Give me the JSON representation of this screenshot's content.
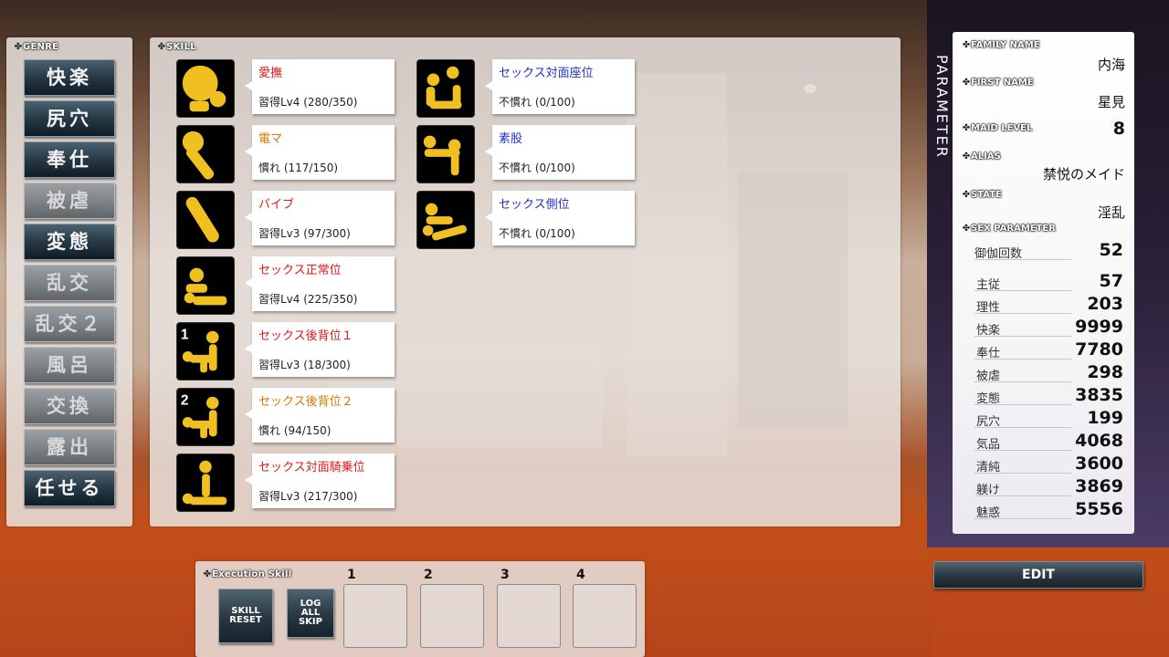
{
  "genre": {
    "title": "GENRE",
    "items": [
      {
        "label": "快楽",
        "enabled": true
      },
      {
        "label": "尻穴",
        "enabled": true
      },
      {
        "label": "奉仕",
        "enabled": true
      },
      {
        "label": "被虐",
        "enabled": false
      },
      {
        "label": "変態",
        "enabled": true
      },
      {
        "label": "乱交",
        "enabled": false
      },
      {
        "label": "乱交２",
        "enabled": false
      },
      {
        "label": "風呂",
        "enabled": false
      },
      {
        "label": "交換",
        "enabled": false
      },
      {
        "label": "露出",
        "enabled": false
      },
      {
        "label": "任せる",
        "enabled": true
      }
    ]
  },
  "skill": {
    "title": "SKILL",
    "left_column": [
      {
        "name": "愛撫",
        "level": "習得Lv4 (280/350)",
        "color": "#e01818",
        "icon": "caress-icon"
      },
      {
        "name": "電マ",
        "level": "慣れ (117/150)",
        "color": "#d87800",
        "icon": "massager-icon"
      },
      {
        "name": "バイブ",
        "level": "習得Lv3 (97/300)",
        "color": "#e01818",
        "icon": "vibrator-icon"
      },
      {
        "name": "セックス正常位",
        "level": "習得Lv4 (225/350)",
        "color": "#e01818",
        "icon": "pose-missionary-icon"
      },
      {
        "name": "セックス後背位１",
        "level": "習得Lv3 (18/300)",
        "color": "#e01818",
        "icon": "pose-rear-1-icon",
        "badge": "1"
      },
      {
        "name": "セックス後背位２",
        "level": "慣れ (94/150)",
        "color": "#d87800",
        "icon": "pose-rear-2-icon",
        "badge": "2"
      },
      {
        "name": "セックス対面騎乗位",
        "level": "習得Lv3 (217/300)",
        "color": "#e01818",
        "icon": "pose-cowgirl-icon"
      }
    ],
    "right_column": [
      {
        "name": "セックス対面座位",
        "level": "不慣れ (0/100)",
        "color": "#2030c8",
        "icon": "pose-seated-icon"
      },
      {
        "name": "素股",
        "level": "不慣れ (0/100)",
        "color": "#2030c8",
        "icon": "pose-thigh-icon"
      },
      {
        "name": "セックス側位",
        "level": "不慣れ (0/100)",
        "color": "#2030c8",
        "icon": "pose-side-icon"
      }
    ]
  },
  "parameter": {
    "vertical_title": "PARAMETER",
    "family_name_label": "FAMILY NAME",
    "family_name": "内海",
    "first_name_label": "FIRST NAME",
    "first_name": "星見",
    "maid_level_label": "MAID LEVEL",
    "maid_level": "8",
    "alias_label": "ALIAS",
    "alias": "禁悦のメイド",
    "state_label": "STATE",
    "state": "淫乱",
    "sex_parameter_label": "SEX PARAMETER",
    "stats": [
      {
        "label": "御伽回数",
        "value": "52"
      },
      {
        "label": "主従",
        "value": "57"
      },
      {
        "label": "理性",
        "value": "203"
      },
      {
        "label": "快楽",
        "value": "9999"
      },
      {
        "label": "奉仕",
        "value": "7780"
      },
      {
        "label": "被虐",
        "value": "298"
      },
      {
        "label": "変態",
        "value": "3835"
      },
      {
        "label": "尻穴",
        "value": "199"
      },
      {
        "label": "気品",
        "value": "4068"
      },
      {
        "label": "清純",
        "value": "3600"
      },
      {
        "label": "躾け",
        "value": "3869"
      },
      {
        "label": "魅惑",
        "value": "5556"
      }
    ],
    "edit_label": "EDIT"
  },
  "execution": {
    "title": "Execution Skill",
    "skill_reset_label": "SKILL RESET",
    "log_all_skip_label": "LOG ALL SKIP",
    "slots": [
      "1",
      "2",
      "3",
      "4"
    ]
  }
}
